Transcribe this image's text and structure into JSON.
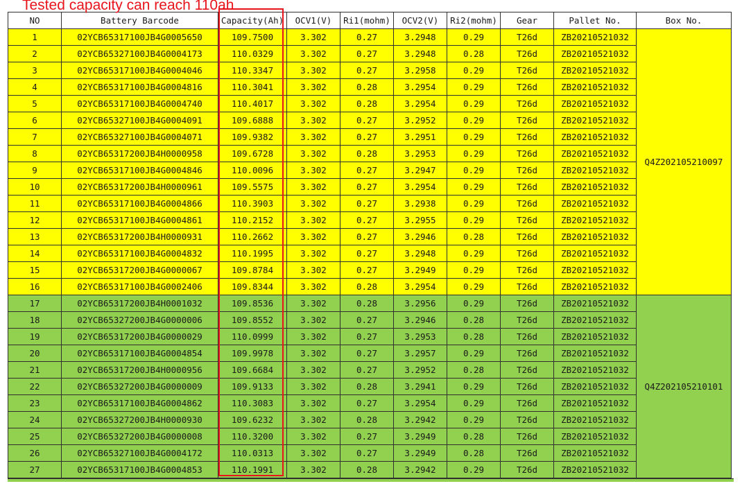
{
  "annotation": "Tested capacity can reach 110ah",
  "headers": [
    "NO",
    "Battery Barcode",
    "Capacity(Ah)",
    "OCV1(V)",
    "Ri1(mohm)",
    "OCV2(V)",
    "Ri2(mohm)",
    "Gear",
    "Pallet No.",
    "Box No."
  ],
  "colors": {
    "yellow": "#ffff00",
    "green": "#92d050",
    "highlight": "#e8141b"
  },
  "groups": [
    {
      "color": "yellow",
      "box": "Q4Z202105210097",
      "rows": [
        [
          "1",
          "02YCB65317100JB4G0005650",
          "109.7500",
          "3.302",
          "0.27",
          "3.2948",
          "0.29",
          "T26d",
          "ZB20210521032"
        ],
        [
          "2",
          "02YCB65327100JB4G0004173",
          "110.0329",
          "3.302",
          "0.27",
          "3.2948",
          "0.28",
          "T26d",
          "ZB20210521032"
        ],
        [
          "3",
          "02YCB65317100JB4G0004046",
          "110.3347",
          "3.302",
          "0.27",
          "3.2958",
          "0.29",
          "T26d",
          "ZB20210521032"
        ],
        [
          "4",
          "02YCB65317100JB4G0004816",
          "110.3041",
          "3.302",
          "0.28",
          "3.2954",
          "0.29",
          "T26d",
          "ZB20210521032"
        ],
        [
          "5",
          "02YCB65317100JB4G0004740",
          "110.4017",
          "3.302",
          "0.28",
          "3.2954",
          "0.29",
          "T26d",
          "ZB20210521032"
        ],
        [
          "6",
          "02YCB65327100JB4G0004091",
          "109.6888",
          "3.302",
          "0.27",
          "3.2952",
          "0.29",
          "T26d",
          "ZB20210521032"
        ],
        [
          "7",
          "02YCB65327100JB4G0004071",
          "109.9382",
          "3.302",
          "0.27",
          "3.2951",
          "0.29",
          "T26d",
          "ZB20210521032"
        ],
        [
          "8",
          "02YCB65317200JB4H0000958",
          "109.6728",
          "3.302",
          "0.28",
          "3.2953",
          "0.29",
          "T26d",
          "ZB20210521032"
        ],
        [
          "9",
          "02YCB65317100JB4G0004846",
          "110.0096",
          "3.302",
          "0.27",
          "3.2947",
          "0.29",
          "T26d",
          "ZB20210521032"
        ],
        [
          "10",
          "02YCB65317200JB4H0000961",
          "109.5575",
          "3.302",
          "0.27",
          "3.2954",
          "0.29",
          "T26d",
          "ZB20210521032"
        ],
        [
          "11",
          "02YCB65317100JB4G0004866",
          "110.3903",
          "3.302",
          "0.27",
          "3.2938",
          "0.29",
          "T26d",
          "ZB20210521032"
        ],
        [
          "12",
          "02YCB65317100JB4G0004861",
          "110.2152",
          "3.302",
          "0.27",
          "3.2955",
          "0.29",
          "T26d",
          "ZB20210521032"
        ],
        [
          "13",
          "02YCB65317200JB4H0000931",
          "110.2662",
          "3.302",
          "0.27",
          "3.2946",
          "0.28",
          "T26d",
          "ZB20210521032"
        ],
        [
          "14",
          "02YCB65317100JB4G0004832",
          "110.1995",
          "3.302",
          "0.27",
          "3.2948",
          "0.29",
          "T26d",
          "ZB20210521032"
        ],
        [
          "15",
          "02YCB65317200JB4G0000067",
          "109.8784",
          "3.302",
          "0.27",
          "3.2949",
          "0.29",
          "T26d",
          "ZB20210521032"
        ],
        [
          "16",
          "02YCB65317100JB4G0002406",
          "109.8344",
          "3.302",
          "0.28",
          "3.2954",
          "0.29",
          "T26d",
          "ZB20210521032"
        ]
      ]
    },
    {
      "color": "green",
      "box": "Q4Z202105210101",
      "rows": [
        [
          "17",
          "02YCB65317200JB4H0001032",
          "109.8536",
          "3.302",
          "0.28",
          "3.2956",
          "0.29",
          "T26d",
          "ZB20210521032"
        ],
        [
          "18",
          "02YCB65327200JB4G0000006",
          "109.8552",
          "3.302",
          "0.27",
          "3.2946",
          "0.28",
          "T26d",
          "ZB20210521032"
        ],
        [
          "19",
          "02YCB65317200JB4G0000029",
          "110.0999",
          "3.302",
          "0.27",
          "3.2953",
          "0.28",
          "T26d",
          "ZB20210521032"
        ],
        [
          "20",
          "02YCB65317100JB4G0004854",
          "109.9978",
          "3.302",
          "0.27",
          "3.2957",
          "0.29",
          "T26d",
          "ZB20210521032"
        ],
        [
          "21",
          "02YCB65317200JB4H0000956",
          "109.6684",
          "3.302",
          "0.27",
          "3.2952",
          "0.28",
          "T26d",
          "ZB20210521032"
        ],
        [
          "22",
          "02YCB65327200JB4G0000009",
          "109.9133",
          "3.302",
          "0.28",
          "3.2941",
          "0.29",
          "T26d",
          "ZB20210521032"
        ],
        [
          "23",
          "02YCB65317100JB4G0004862",
          "110.3083",
          "3.302",
          "0.27",
          "3.2954",
          "0.29",
          "T26d",
          "ZB20210521032"
        ],
        [
          "24",
          "02YCB65327200JB4H0000930",
          "109.6232",
          "3.302",
          "0.28",
          "3.2942",
          "0.29",
          "T26d",
          "ZB20210521032"
        ],
        [
          "25",
          "02YCB65327200JB4G0000008",
          "110.3200",
          "3.302",
          "0.27",
          "3.2949",
          "0.28",
          "T26d",
          "ZB20210521032"
        ],
        [
          "26",
          "02YCB65327100JB4G0004172",
          "110.0313",
          "3.302",
          "0.27",
          "3.2949",
          "0.28",
          "T26d",
          "ZB20210521032"
        ],
        [
          "27",
          "02YCB65317100JB4G0004853",
          "110.1991",
          "3.302",
          "0.28",
          "3.2942",
          "0.29",
          "T26d",
          "ZB20210521032"
        ]
      ]
    }
  ]
}
